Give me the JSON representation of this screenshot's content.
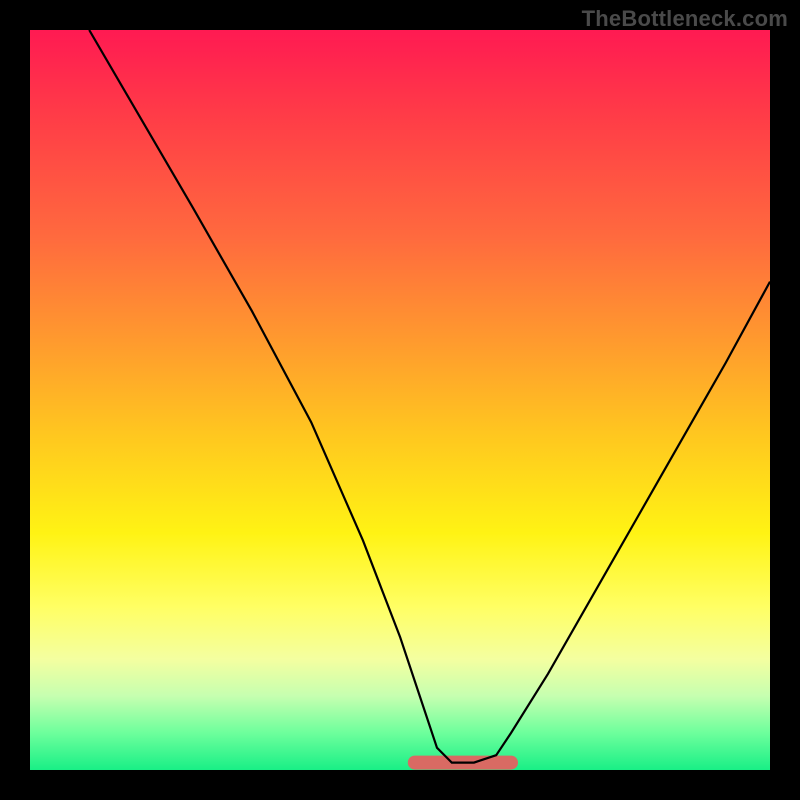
{
  "watermark": "TheBottleneck.com",
  "chart_data": {
    "type": "line",
    "title": "",
    "xlabel": "",
    "ylabel": "",
    "xlim": [
      0,
      100
    ],
    "ylim": [
      0,
      100
    ],
    "background_gradient": {
      "top": "#ff1a52",
      "mid": "#fff314",
      "bottom": "#19ef86"
    },
    "series": [
      {
        "name": "bottleneck-curve",
        "color": "#000000",
        "x": [
          8,
          15,
          22,
          30,
          38,
          45,
          50,
          53,
          55,
          57,
          60,
          63,
          65,
          70,
          78,
          86,
          94,
          100
        ],
        "y": [
          100,
          88,
          76,
          62,
          47,
          31,
          18,
          9,
          3,
          1,
          1,
          2,
          5,
          13,
          27,
          41,
          55,
          66
        ]
      }
    ],
    "annotations": [
      {
        "name": "optimal-flat-region",
        "color": "#d96a63",
        "x_start": 52,
        "x_end": 65,
        "y": 1
      }
    ]
  }
}
